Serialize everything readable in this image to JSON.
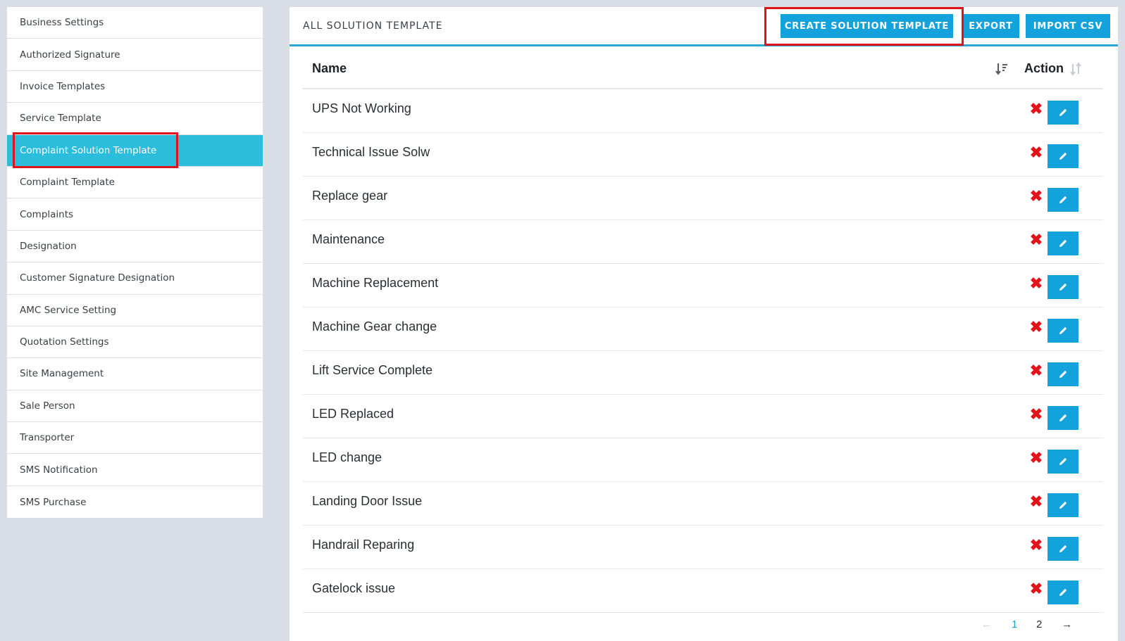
{
  "sidebar": {
    "items": [
      {
        "label": "Business  Settings"
      },
      {
        "label": "Authorized  Signature"
      },
      {
        "label": "Invoice  Templates"
      },
      {
        "label": "Service  Template"
      },
      {
        "label": "Complaint  Solution  Template",
        "active": true
      },
      {
        "label": "Complaint  Template"
      },
      {
        "label": "Complaints"
      },
      {
        "label": "Designation"
      },
      {
        "label": "Customer  Signature  Designation"
      },
      {
        "label": "AMC  Service  Setting"
      },
      {
        "label": "Quotation  Settings"
      },
      {
        "label": "Site  Management"
      },
      {
        "label": "Sale  Person"
      },
      {
        "label": "Transporter"
      },
      {
        "label": "SMS  Notification"
      },
      {
        "label": "SMS  Purchase"
      }
    ]
  },
  "header": {
    "title": "ALL SOLUTION TEMPLATE",
    "create_label": "CREATE SOLUTION TEMPLATE",
    "export_label": "EXPORT",
    "import_label": "IMPORT CSV"
  },
  "table": {
    "columns": {
      "name": "Name",
      "action": "Action"
    },
    "rows": [
      {
        "name": "UPS Not Working"
      },
      {
        "name": "Technical Issue Solw"
      },
      {
        "name": "Replace gear"
      },
      {
        "name": "Maintenance"
      },
      {
        "name": "Machine Replacement"
      },
      {
        "name": "Machine Gear change"
      },
      {
        "name": "Lift Service Complete"
      },
      {
        "name": "LED Replaced"
      },
      {
        "name": "LED change"
      },
      {
        "name": "Landing Door Issue"
      },
      {
        "name": "Handrail Reparing"
      },
      {
        "name": "Gatelock issue"
      }
    ]
  },
  "pagination": {
    "prev": "←",
    "page1": "1",
    "page2": "2",
    "next": "→"
  },
  "icons": {
    "sort": "sort-icon",
    "delete": "delete-icon",
    "edit": "pencil-icon"
  },
  "colors": {
    "accent": "#13a2dc",
    "active_sidebar": "#2cbcdc",
    "highlight": "#e0131b"
  }
}
